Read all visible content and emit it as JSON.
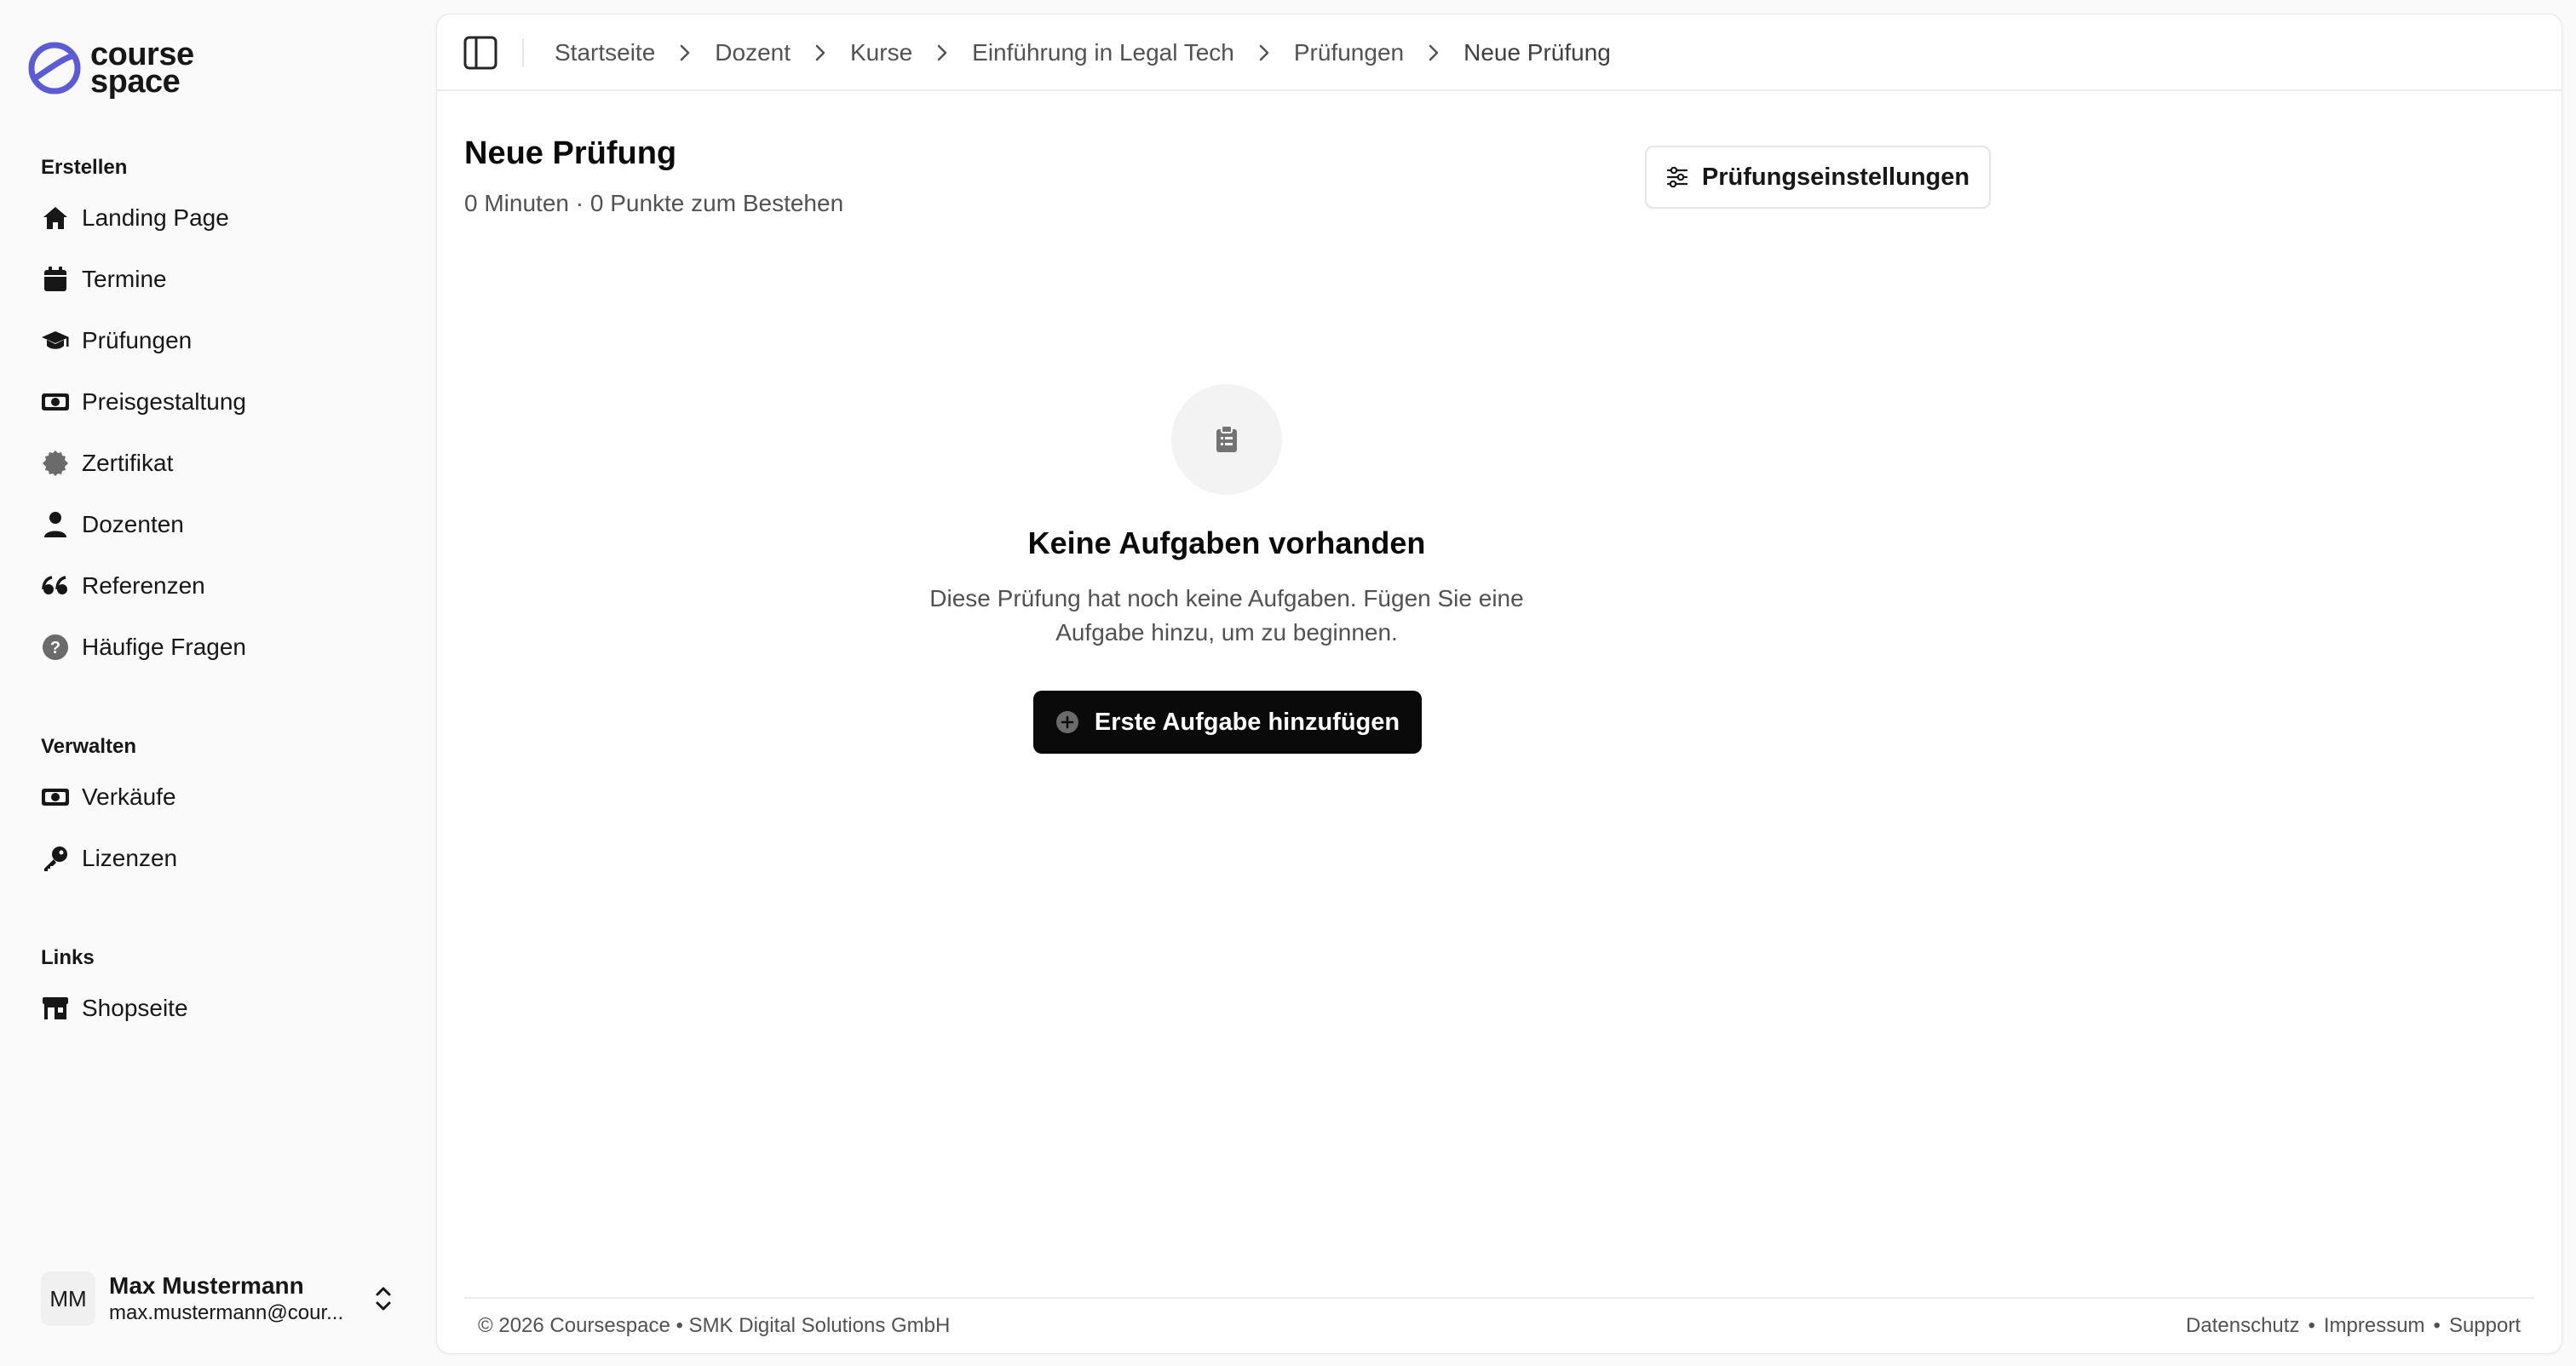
{
  "app": {
    "logo_text_line1": "course",
    "logo_text_line2": "space",
    "brand_color": "#5b5bd6"
  },
  "sidebar": {
    "sections": [
      {
        "heading": "Erstellen",
        "items": [
          {
            "label": "Landing Page",
            "icon": "home-icon"
          },
          {
            "label": "Termine",
            "icon": "calendar-icon"
          },
          {
            "label": "Prüfungen",
            "icon": "graduation-cap-icon"
          },
          {
            "label": "Preisgestaltung",
            "icon": "banknote-icon"
          },
          {
            "label": "Zertifikat",
            "icon": "badge-icon"
          },
          {
            "label": "Dozenten",
            "icon": "person-icon"
          },
          {
            "label": "Referenzen",
            "icon": "quote-icon"
          },
          {
            "label": "Häufige Fragen",
            "icon": "question-circle-icon"
          }
        ]
      },
      {
        "heading": "Verwalten",
        "items": [
          {
            "label": "Verkäufe",
            "icon": "banknote-icon"
          },
          {
            "label": "Lizenzen",
            "icon": "key-icon"
          }
        ]
      },
      {
        "heading": "Links",
        "items": [
          {
            "label": "Shopseite",
            "icon": "store-icon"
          }
        ]
      }
    ],
    "user": {
      "initials": "MM",
      "name": "Max Mustermann",
      "email": "max.mustermann@cour..."
    }
  },
  "topbar": {
    "breadcrumb": [
      "Startseite",
      "Dozent",
      "Kurse",
      "Einführung in Legal Tech",
      "Prüfungen",
      "Neue Prüfung"
    ]
  },
  "main": {
    "title": "Neue Prüfung",
    "subtitle": "0 Minuten · 0 Punkte zum Bestehen",
    "settings_button": "Prüfungseinstellungen",
    "empty_state": {
      "title": "Keine Aufgaben vorhanden",
      "description_line1": "Diese Prüfung hat noch keine Aufgaben. Fügen Sie eine",
      "description_line2": "Aufgabe hinzu, um zu beginnen.",
      "button": "Erste Aufgabe hinzufügen",
      "icon": "clipboard-icon"
    }
  },
  "footer": {
    "copyright": "© 2026 Coursespace • SMK Digital Solutions GmbH",
    "links": [
      "Datenschutz",
      "Impressum",
      "Support"
    ],
    "separator": "•"
  }
}
